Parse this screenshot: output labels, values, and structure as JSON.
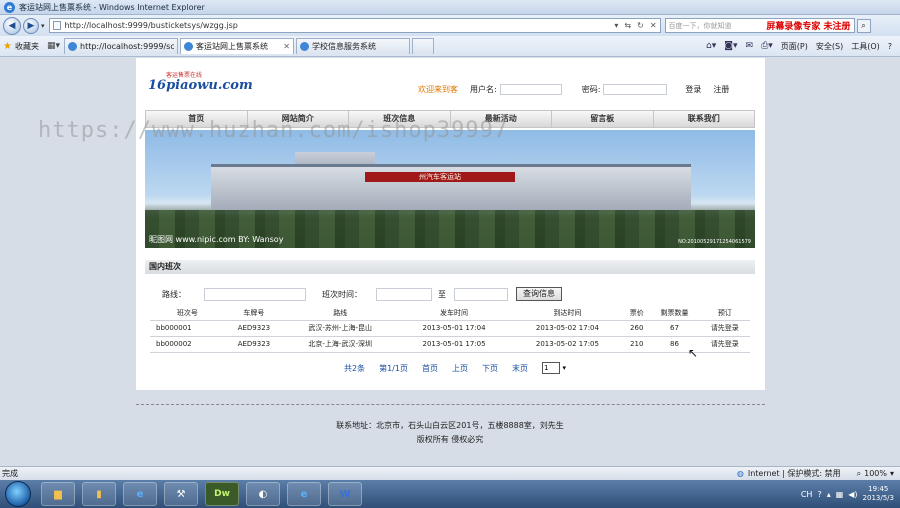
{
  "window": {
    "title": "客运站网上售票系统 - Windows Internet Explorer"
  },
  "address": {
    "url": "http://localhost:9999/busticketsys/wzgg.jsp",
    "search_placeholder": "百度一下，你就知道",
    "recording_text": "屏幕录像专家 未注册"
  },
  "favorites": {
    "label": "收藏夹"
  },
  "tabs": [
    {
      "label": "http://localhost:9999/sc...",
      "active": false
    },
    {
      "label": "客运站网上售票系统",
      "active": true
    },
    {
      "label": "学校信息服务系统",
      "active": false
    }
  ],
  "commandbar": {
    "page": "页面(P)",
    "safety": "安全(S)",
    "tools": "工具(O)",
    "help": "?"
  },
  "site": {
    "logo_text": "16piaowu.com",
    "logo_sub": "客运售票在线",
    "login": {
      "welcome": "欢迎来到客",
      "username_label": "用户名:",
      "password_label": "密码:",
      "login_link": "登录",
      "register_link": "注册"
    },
    "nav": [
      "首页",
      "网站简介",
      "班次信息",
      "最新活动",
      "留言板",
      "联系我们"
    ],
    "banner": {
      "station_sign": "州汽车客运站",
      "watermark_left": "昵图网 www.nipic.com",
      "watermark_mid": "BY: Wansoy",
      "watermark_right": "NO:20100529171254061579"
    },
    "section_title": "国内班次",
    "search": {
      "route_label": "路线：",
      "time_label": "班次时间：",
      "to_label": "至",
      "button": "查询信息"
    },
    "table": {
      "headers": [
        "班次号",
        "车牌号",
        "路线",
        "发车时间",
        "到达时间",
        "票价",
        "剩票数量",
        "预订"
      ],
      "rows": [
        [
          "bb000001",
          "AED9323",
          "武汉-苏州-上海-昆山",
          "2013-05-01 17:04",
          "2013-05-02 17:04",
          "260",
          "67",
          "请先登录"
        ],
        [
          "bb000002",
          "AED9323",
          "北京-上海-武汉-深圳",
          "2013-05-01 17:05",
          "2013-05-02 17:05",
          "210",
          "86",
          "请先登录"
        ]
      ]
    },
    "pager": {
      "total": "共2条",
      "page_info": "第1/1页",
      "first": "首页",
      "prev": "上页",
      "next": "下页",
      "last": "末页",
      "select_value": "1"
    },
    "footer": {
      "address": "联系地址：北京市，石头山白云区201号，五楼8888室，刘先生",
      "copyright": "版权所有 侵权必究"
    }
  },
  "overlay_watermark": "https://www.huzhan.com/ishop39997",
  "statusbar": {
    "status": "完成",
    "zone": "Internet | 保护模式: 禁用",
    "zoom": "100%"
  },
  "taskbar": {
    "clock_time": "19:45",
    "clock_date": "2013/5/3",
    "dw_label": "Dw",
    "lang": "CH"
  }
}
